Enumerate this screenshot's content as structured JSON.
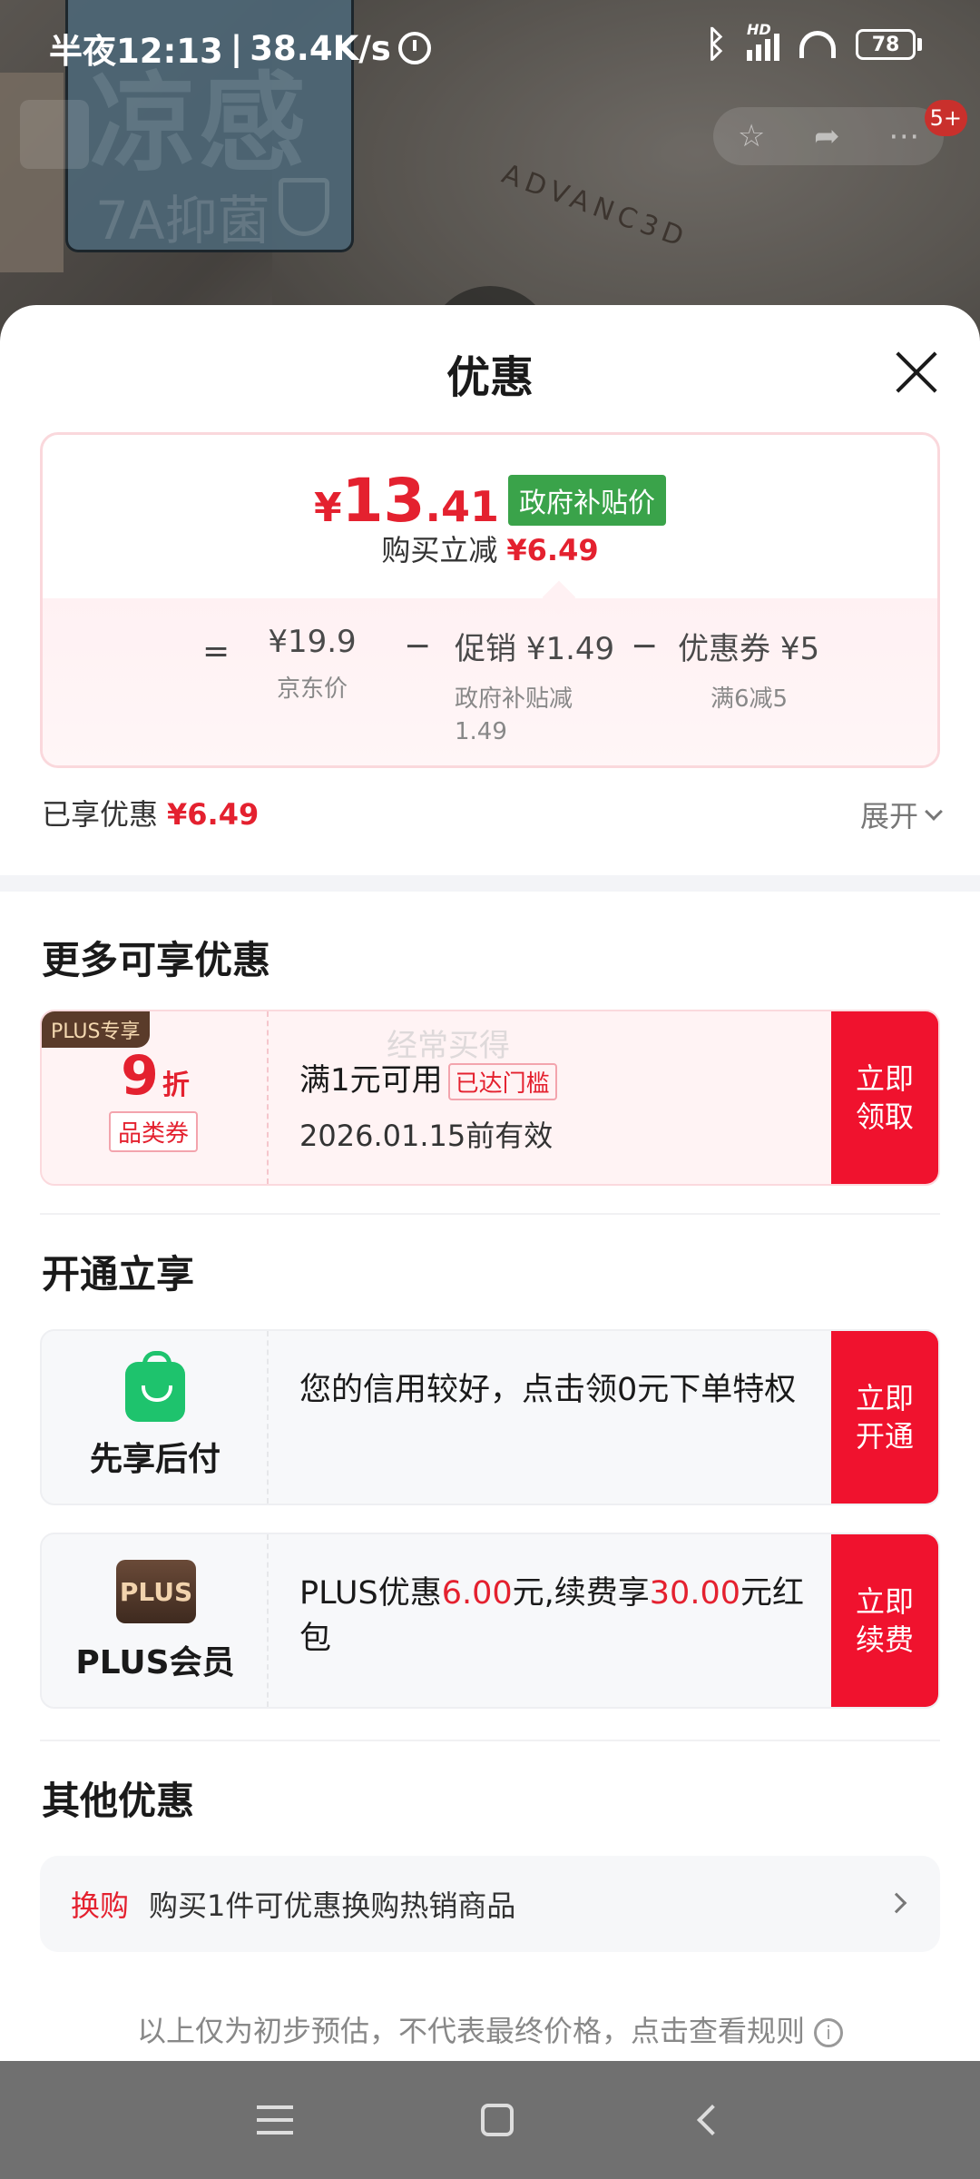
{
  "status_bar": {
    "time": "半夜12:13",
    "network_speed": "38.4K/s",
    "hd_label": "HD",
    "battery": "78"
  },
  "background": {
    "tag_big_text": "凉感",
    "tag_small_text": "7A抑菌",
    "brand_text": "ADVANC3D",
    "badge": "5+"
  },
  "sheet": {
    "title": "优惠",
    "price_card": {
      "currency": "¥",
      "price_int": "13",
      "price_dec": ".41",
      "gov_tag": "政府补贴价",
      "save_label": "购买立减",
      "save_amount": "¥6.49",
      "calc": {
        "eq": "=",
        "minus": "−",
        "base_value": "¥19.9",
        "base_label": "京东价",
        "promo_label": "促销",
        "promo_value": "¥1.49",
        "promo_sub": "政府补贴减",
        "promo_sub2": "1.49",
        "coupon_label": "优惠券",
        "coupon_value": "¥5",
        "coupon_sub": "满6减5"
      }
    },
    "enjoyed_label": "已享优惠",
    "enjoyed_amount": "¥6.49",
    "expand_label": "展开"
  },
  "more": {
    "title": "更多可享优惠",
    "coupon": {
      "plus_tag": "PLUS专享",
      "discount_num": "9",
      "discount_unit": "折",
      "category": "品类券",
      "condition": "满1元可用",
      "reached": "已达门槛",
      "valid": "2026.01.15前有效",
      "watermark": "经常买得",
      "button": "立即 领取"
    }
  },
  "open": {
    "title": "开通立享",
    "pay_later": {
      "label": "先享后付",
      "text": "您的信用较好，点击领0元下单特权",
      "button": "立即 开通"
    },
    "plus": {
      "icon_text": "PLUS",
      "label": "PLUS会员",
      "text_a": "PLUS优惠",
      "amount_a": "6.00",
      "text_b": "元,续费享",
      "amount_b": "30.00",
      "text_c": "元红包",
      "button": "立即 续费"
    }
  },
  "other": {
    "title": "其他优惠",
    "swap_label": "换购",
    "swap_text": "购买1件可优惠换购热销商品"
  },
  "footer_note": "以上仅为初步预估，不代表最终价格，点击查看规则",
  "colors": {
    "accent_red": "#e4212f",
    "button_red": "#f0122e",
    "gov_green": "#3aa34a"
  }
}
